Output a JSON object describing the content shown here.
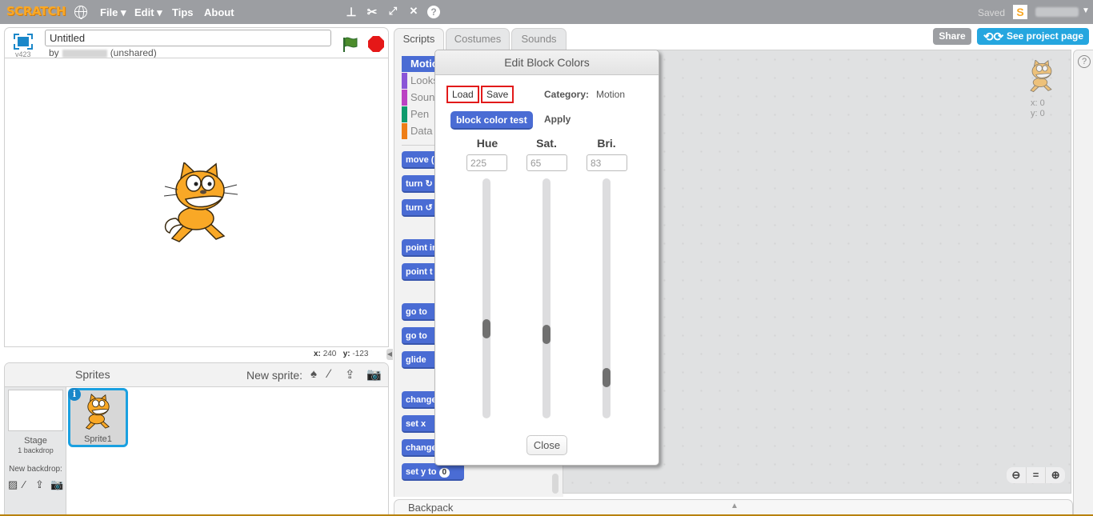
{
  "topbar": {
    "logo": "SCRATCH",
    "menus": [
      "File ▾",
      "Edit ▾",
      "Tips",
      "About"
    ],
    "tools": [
      "duplicate-stamp",
      "delete-scissors",
      "grow",
      "shrink",
      "help"
    ],
    "status": "Saved",
    "account_icon": "S"
  },
  "stage": {
    "version": "v423",
    "project_title": "Untitled",
    "by_label": "by",
    "share_status": "(unshared)",
    "mouse_x_label": "x:",
    "mouse_x": "240",
    "mouse_y_label": "y:",
    "mouse_y": "-123"
  },
  "sprites_pane": {
    "title": "Sprites",
    "new_sprite_label": "New sprite:",
    "stage_label": "Stage",
    "backdrop_count": "1 backdrop",
    "new_backdrop_label": "New backdrop:",
    "sprites": [
      {
        "name": "Sprite1",
        "info": "i"
      }
    ]
  },
  "tabs": [
    {
      "label": "Scripts",
      "active": true
    },
    {
      "label": "Costumes",
      "active": false
    },
    {
      "label": "Sounds",
      "active": false
    }
  ],
  "header_buttons": {
    "share": "Share",
    "see_project": "See project page"
  },
  "palette": {
    "categories": [
      {
        "label": "Motion",
        "color": "#4a6cd4",
        "selected": true
      },
      {
        "label": "Looks",
        "color": "#8a55d7"
      },
      {
        "label": "Sound",
        "color": "#bb42c3"
      },
      {
        "label": "Pen",
        "color": "#0e9a6c"
      },
      {
        "label": "Data",
        "color": "#ee7d16"
      }
    ],
    "blocks": [
      "move (",
      "turn ↻",
      "turn ↺",
      "point in",
      "point t",
      "go to",
      "go to",
      "glide",
      "change",
      "set x",
      "change",
      "set y to"
    ],
    "last_block_value": "0"
  },
  "scripts_area": {
    "sprite_x": "x: 0",
    "sprite_y": "y: 0",
    "zoom_controls": [
      "zoom-out",
      "reset",
      "zoom-in"
    ]
  },
  "backpack": {
    "label": "Backpack"
  },
  "dialog": {
    "title": "Edit Block Colors",
    "load": "Load",
    "save": "Save",
    "category_label": "Category:",
    "category_value": "Motion",
    "test_block": "block color test",
    "apply": "Apply",
    "sliders": [
      {
        "label": "Hue",
        "value": "225",
        "fraction": 0.625
      },
      {
        "label": "Sat.",
        "value": "65",
        "fraction": 0.65
      },
      {
        "label": "Bri.",
        "value": "83",
        "fraction": 0.83
      }
    ],
    "close": "Close",
    "accent_highlight": "#e21a1a"
  },
  "help_panel": {
    "icon": "?"
  }
}
